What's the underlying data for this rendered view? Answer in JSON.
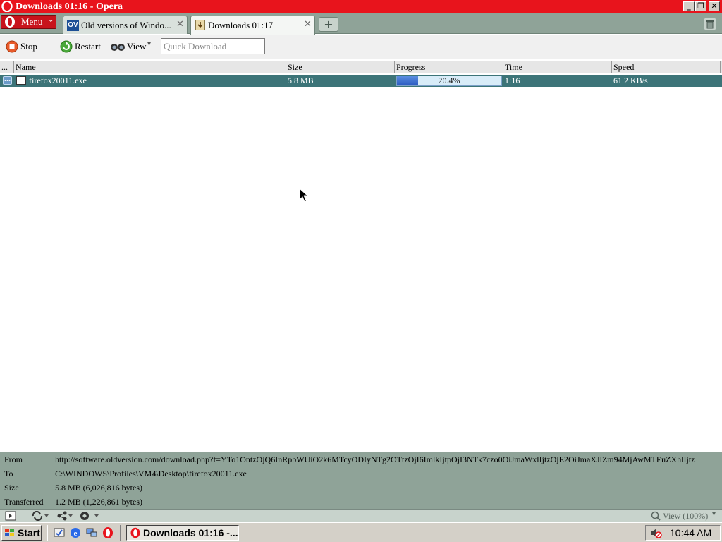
{
  "window": {
    "title": "Downloads 01:16 - Opera",
    "minimize_glyph": "_",
    "restore_glyph": "❐",
    "close_glyph": "✕"
  },
  "menu": {
    "label": "Menu",
    "chevron": "⌄"
  },
  "tabs": [
    {
      "label": "Old versions of Windo...",
      "favicon_text": "OV",
      "close": "✕"
    },
    {
      "label": "Downloads 01:17",
      "close": "✕"
    }
  ],
  "new_tab": "+",
  "toolbar": {
    "stop_label": "Stop",
    "restart_label": "Restart",
    "view_label": "View",
    "quick_download_placeholder": "Quick Download"
  },
  "table": {
    "columns": [
      "...",
      "Name",
      "Size",
      "Progress",
      "Time",
      "Speed"
    ],
    "rows": [
      {
        "name": "firefox20011.exe",
        "size": "5.8 MB",
        "progress_text": "20.4%",
        "progress_value": 0.204,
        "time": "1:16",
        "speed": "61.2 KB/s"
      }
    ]
  },
  "details": {
    "from_label": "From",
    "from_value": "http://software.oldversion.com/download.php?f=YTo1OntzOjQ6InRpbWUiO2k6MTcyODIyNTg2OTtzOjI6ImlkIjtpOjI3NTk7czo0OiJmaWxlIjtzOjE2OiJmaXJlZm94MjAwMTEuZXhlIjtz",
    "to_label": "To",
    "to_value": "C:\\WINDOWS\\Profiles\\VM4\\Desktop\\firefox20011.exe",
    "size_label": "Size",
    "size_value": "5.8 MB (6,026,816 bytes)",
    "transferred_label": "Transferred",
    "transferred_value": "1.2 MB (1,226,861 bytes)"
  },
  "statusbar": {
    "zoom": "View (100%)"
  },
  "taskbar": {
    "start_label": "Start",
    "task_label": "Downloads 01:16 -...",
    "clock": "10:44 AM"
  },
  "colors": {
    "title_bar": "#e8141c",
    "panel": "#8fa398",
    "selected_row": "#3c7478",
    "progress_fill": "#2a5ac0"
  }
}
